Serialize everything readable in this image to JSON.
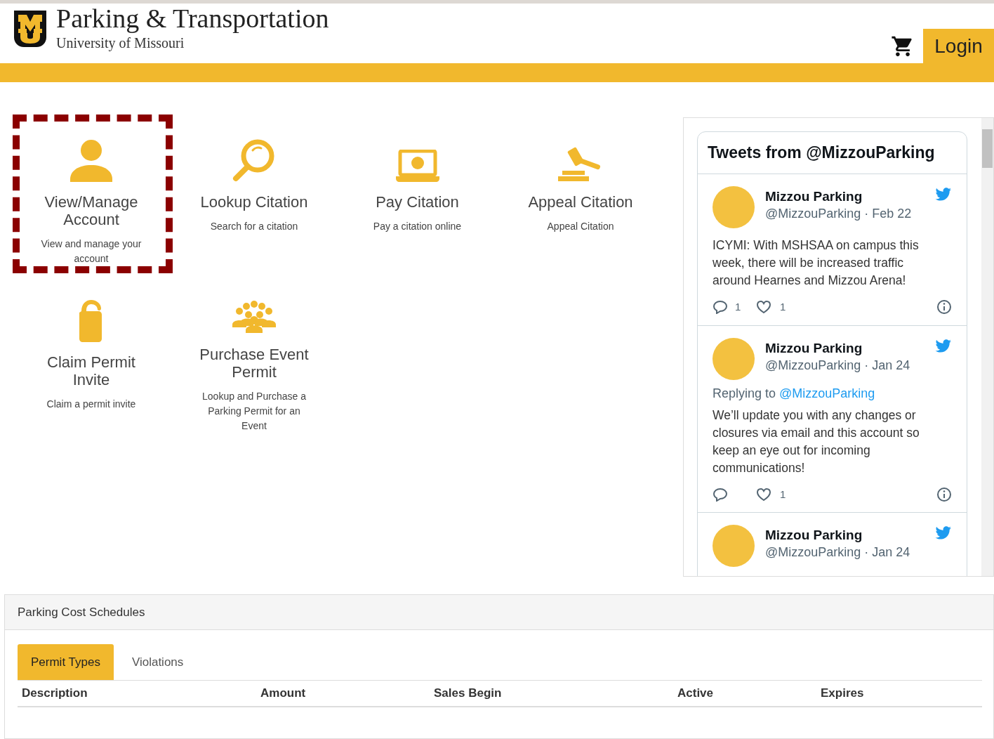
{
  "header": {
    "title": "Parking & Transportation",
    "subtitle": "University of Missouri",
    "login": "Login"
  },
  "tiles": [
    {
      "kind": "person",
      "title": "View/Manage Account",
      "description": "View and manage your account",
      "highlighted": true
    },
    {
      "kind": "search",
      "title": "Lookup Citation",
      "description": "Search for a citation",
      "highlighted": false
    },
    {
      "kind": "laptop",
      "title": "Pay Citation",
      "description": "Pay a citation online",
      "highlighted": false
    },
    {
      "kind": "gavel",
      "title": "Appeal Citation",
      "description": "Appeal Citation",
      "highlighted": false
    },
    {
      "kind": "hanger",
      "title": "Claim Permit Invite",
      "description": "Claim a permit invite",
      "highlighted": false
    },
    {
      "kind": "crowd",
      "title": "Purchase Event Permit",
      "description": "Lookup and Purchase a Parking Permit for an Event",
      "highlighted": false
    }
  ],
  "twitter": {
    "title": "Tweets from @MizzouParking",
    "tweets": [
      {
        "name": "Mizzou Parking",
        "handle": "@MizzouParking · Feb 22",
        "text": "ICYMI: With MSHSAA on campus this week, there will be increased traffic around Hearnes and Mizzou Arena!",
        "replies": "1",
        "likes": "1"
      },
      {
        "name": "Mizzou Parking",
        "handle": "@MizzouParking · Jan 24",
        "replying_label": "Replying to",
        "replying_to": "@MizzouParking",
        "text": "We’ll update you with any changes or closures via email and this account so keep an eye out for incoming communications!",
        "likes": "1"
      },
      {
        "name": "Mizzou Parking",
        "handle": "@MizzouParking · Jan 24"
      }
    ]
  },
  "schedules": {
    "title": "Parking Cost Schedules",
    "tabs": [
      {
        "label": "Permit Types",
        "selected": true
      },
      {
        "label": "Violations",
        "selected": false
      }
    ],
    "columns": [
      "Description",
      "Amount",
      "Sales Begin",
      "Active",
      "Expires"
    ]
  }
}
